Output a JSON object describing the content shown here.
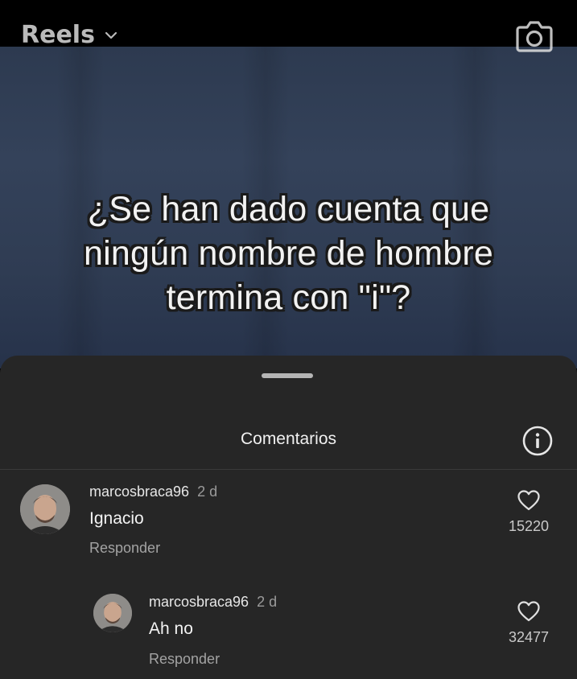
{
  "header": {
    "title": "Reels",
    "dropdown_icon": "chevron-down-icon",
    "camera_icon": "camera-icon"
  },
  "video": {
    "caption_lines": [
      "¿Se han dado cuenta que",
      "ningún nombre de hombre",
      "termina con \"i\"?"
    ],
    "background_color": "#2f3c53"
  },
  "comments_sheet": {
    "title": "Comentarios",
    "info_icon": "info-icon",
    "comments": [
      {
        "username": "marcosbraca96",
        "time": "2 d",
        "text": "Ignacio",
        "reply_label": "Responder",
        "likes": "15220"
      }
    ],
    "replies": [
      {
        "username": "marcosbraca96",
        "time": "2 d",
        "text": "Ah no",
        "reply_label": "Responder",
        "likes": "32477"
      }
    ]
  },
  "colors": {
    "sheet_background": "#262626",
    "text_primary": "#f3f3f3",
    "text_secondary": "#a3a3a3"
  }
}
